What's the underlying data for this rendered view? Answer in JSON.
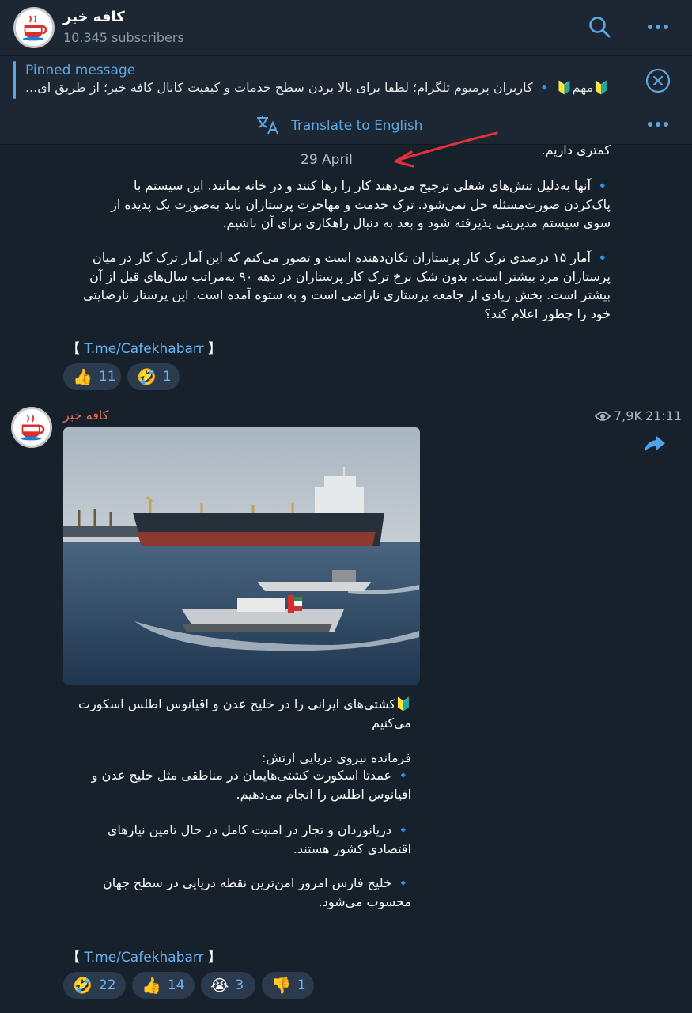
{
  "header": {
    "channel_name": "کافه خبر",
    "subscribers": "10.345 subscribers"
  },
  "pinned": {
    "title": "Pinned message",
    "text": "🔰مهم🔰 🔹 کاربران پرمیوم تلگرام؛ لطفا برای بالا بردن سطح خدمات و کیفیت کانال کافه خبر؛ از طریق ای..."
  },
  "translate": {
    "label": "Translate to English"
  },
  "message1": {
    "partial_line": "کمتری داریم.",
    "date": "29 April",
    "para1": [
      "🔹 آنها به‌دلیل تنش‌های شغلی ترجیح می‌دهند کار را رها کنند و در خانه بمانند. این سیستم با",
      "پاک‌کردن صورت‌مسئله حل نمی‌شود. ترک خدمت و مهاجرت پرستاران باید به‌صورت یک پدیده از",
      "سوی سیستم مدیریتی پذیرفته شود و بعد به دنبال راهکاری برای آن باشیم."
    ],
    "para2": [
      "🔹 آمار ۱۵ درصدی ترک کار پرستاران تکان‌دهنده است و تصور می‌کنم که این آمار ترک کار در میان",
      "پرستاران مرد بیشتر است. بدون شک نرخ ترک کار پرستاران در دهه ۹۰ به‌مراتب سال‌های قبل از آن",
      "بیشتر است. بخش زیادی از جامعه پرستاری ناراضی است و به ستوه آمده است. این پرستار نارضایتی",
      "خود را چطور اعلام کند؟"
    ],
    "link_open": "【",
    "link": "T.me/Cafekhabarr",
    "link_close": "】",
    "reactions": [
      {
        "emoji": "👍",
        "count": "11"
      },
      {
        "emoji": "🤣",
        "count": "1"
      }
    ]
  },
  "message2": {
    "channel_name": "کافه خبر",
    "views": "7,9K",
    "time": "21:11",
    "caption_title": [
      "🔰کشتی‌های ایرانی را در خلیج عدن و اقیانوس اطلس اسکورت",
      "می‌کنیم"
    ],
    "commander": "فرمانده نیروی دریایی ارتش:",
    "point1": [
      "🔹 عمدتا اسکورت کشتی‌هایمان در مناطقی مثل خلیج عدن و",
      "اقیانوس اطلس را انجام می‌دهیم."
    ],
    "point2": [
      "🔹 دریانوردان و تجار در امنیت کامل در حال تامین نیازهای",
      "اقتصادی کشور هستند."
    ],
    "point3": [
      "🔹 خلیج فارس امروز امن‌ترین نقطه دریایی در سطح جهان",
      "محسوب می‌شود."
    ],
    "link_open": "【",
    "link": "T.me/Cafekhabarr",
    "link_close": "】",
    "reactions": [
      {
        "emoji": "🤣",
        "count": "22"
      },
      {
        "emoji": "👍",
        "count": "14"
      },
      {
        "emoji": "😭",
        "count": "3"
      },
      {
        "emoji": "👎",
        "count": "1"
      }
    ]
  },
  "colors": {
    "background": "#17212b",
    "header": "#1c2733",
    "accent": "#5ea6e0",
    "channel_name": "#e86e57",
    "annotation_arrow": "#e0303c"
  },
  "icons": [
    "search-icon",
    "more-icon",
    "close-icon",
    "translate-icon",
    "eye-icon",
    "share-icon"
  ]
}
